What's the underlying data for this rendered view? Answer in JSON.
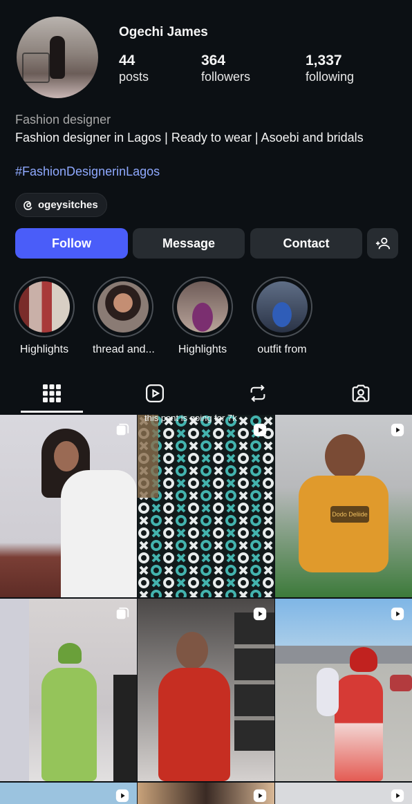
{
  "profile": {
    "name": "Ogechi James",
    "stats": [
      {
        "value": "44",
        "label": "posts"
      },
      {
        "value": "364",
        "label": "followers"
      },
      {
        "value": "1,337",
        "label": "following"
      }
    ],
    "category": "Fashion designer",
    "bio": "Fashion designer in Lagos | Ready to wear | Asoebi and bridals",
    "hashtag": "#FashionDesignerinLagos",
    "threads_handle": "ogeysitches"
  },
  "actions": {
    "follow": "Follow",
    "message": "Message",
    "contact": "Contact",
    "suggest_icon": "add-person-icon"
  },
  "highlights": [
    {
      "label": "Highlights"
    },
    {
      "label": "thread and..."
    },
    {
      "label": "Highlights"
    },
    {
      "label": "outfit from"
    }
  ],
  "tabs": [
    {
      "icon": "grid-icon",
      "active": true
    },
    {
      "icon": "reels-icon",
      "active": false
    },
    {
      "icon": "reposts-icon",
      "active": false
    },
    {
      "icon": "tagged-icon",
      "active": false
    }
  ],
  "posts": [
    {
      "type": "carousel"
    },
    {
      "type": "reel",
      "overlay_text": "this pant is going for 7k"
    },
    {
      "type": "reel",
      "overlay_text": "Dodo Deliide"
    },
    {
      "type": "carousel"
    },
    {
      "type": "reel"
    },
    {
      "type": "reel"
    }
  ],
  "colors": {
    "background": "#0c1014",
    "primary_button": "#4a5df9",
    "secondary_button": "#272c31",
    "link": "#8fa9ff"
  }
}
